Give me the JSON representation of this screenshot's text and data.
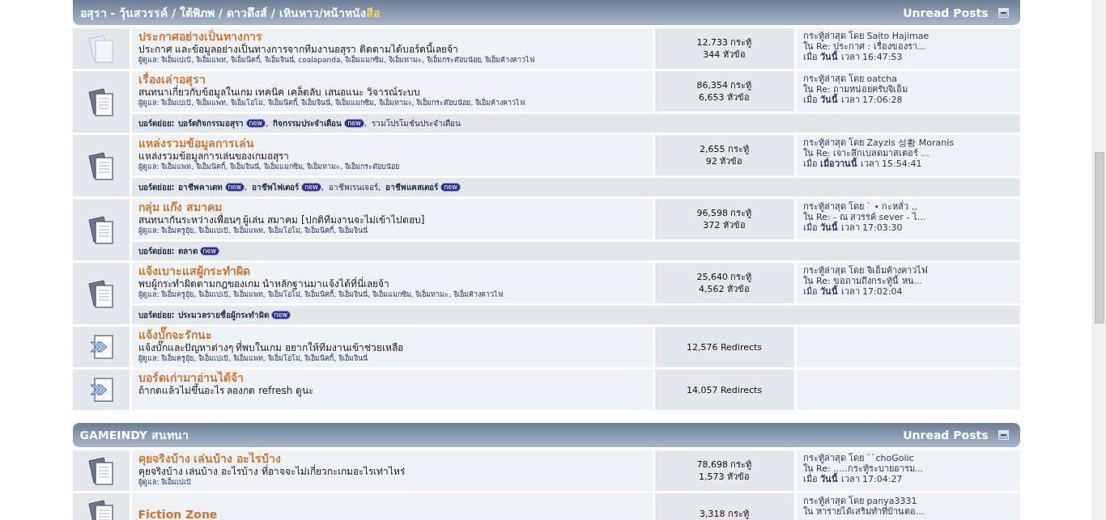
{
  "categories": [
    {
      "title_parts": [
        {
          "text": "อสุรา - วุ้นสวรรค์ / ใต้พิภพ / ดาวดึงส์ / เหินหาว/หน้าหนัง",
          "highlighted": false
        },
        {
          "text": "สือ",
          "highlighted": true
        }
      ],
      "unread_label": "Unread Posts",
      "forums": [
        {
          "kind": "forum",
          "unread": false,
          "title": "ประกาศอย่างเป็นทางการ",
          "description": "ประกาศ และข้อมูลอย่างเป็นทางการจากทีมงานอสุรา ติดตามได้บอร์ดนี้เลยจ้า",
          "moderators_label": "ผู้ดูแล:",
          "moderators": "จิเอ็มเปเป้, จิเอ็มแพท, จิเอ็มนิคกี้, จิเอ็มจินนี่, coalapanda, จิเอ็มแมกซิม, จิเอ็มทามะ, จิเอ็มกระต๊อบน้อย, จิเอ็มค้างคาวไฟ",
          "posts": "12,733 กระทู้",
          "threads": "344 หัวข้อ",
          "last_post": {
            "by_label": "กระทู้ล่าสุด โดย",
            "user": "Saito Hajimae",
            "in_label": "ใน",
            "thread": "Re: ประกาศ : เรื่องของรา...",
            "at_label": "เมื่อ",
            "day": "วันนี้",
            "time_label": "เวลา",
            "time": "16:47:53"
          }
        },
        {
          "kind": "forum",
          "unread": true,
          "title": "เรื่องเล่าอสุรา",
          "description": "สนทนาเกี่ยวกับข้อมูลในเกม เทคนิค เคล็ดลับ เสนอแนะ วิจารณ์ระบบ",
          "moderators_label": "ผู้ดูแล:",
          "moderators": "จิเอ็มเปเป้, จิเอ็มแพท, จิเอ็มโอโม่, จิเอ็มนิคกี้, จิเอ็มจินนี่, จิเอ็มแมกซิม, จิเอ็มทามะ, จิเอ็มกระต๊อบน้อย, จิเอ็มค้างคาวไฟ",
          "posts": "86,354 กระทู้",
          "threads": "6,653 หัวข้อ",
          "last_post": {
            "by_label": "กระทู้ล่าสุด โดย",
            "user": "oatcha",
            "in_label": "ใน",
            "thread": "Re: ถามหน่อยครับจิเอ็ม",
            "at_label": "เมื่อ",
            "day": "วันนี้",
            "time_label": "เวลา",
            "time": "17:06:28"
          },
          "subforums": {
            "label": "บอร์ดย่อย:",
            "separator": ",",
            "items": [
              {
                "name": "บอร์ดกิจกรรมอสุรา",
                "new": true,
                "badge": "new"
              },
              {
                "name": "กิจกรรมประจำเดือน",
                "new": true,
                "badge": "new"
              },
              {
                "name": "รวมโปรโมชั่นประจำเดือน",
                "new": false
              }
            ]
          }
        },
        {
          "kind": "forum",
          "unread": true,
          "title": "แหล่งรวมข้อมูลการเล่น",
          "description": "แหล่งรวมข้อมูลการเล่นของเกมอสุรา",
          "moderators_label": "ผู้ดูแล:",
          "moderators": "จิเอ็มแพท, จิเอ็มนิคกี้, จิเอ็มจินนี่, จิเอ็มแมกซิม, จิเอ็มทามะ, จิเอ็มกระต๊อบน้อย",
          "posts": "2,655 กระทู้",
          "threads": "92 หัวข้อ",
          "last_post": {
            "by_label": "กระทู้ล่าสุด โดย",
            "user": "Zayzis 성황 Moranis",
            "in_label": "ใน",
            "thread": "Re: เจาะลึกเบลดมาสเตอร์ ...",
            "at_label": "เมื่อ",
            "day": "เมื่อวานนี้",
            "time_label": "เวลา",
            "time": "15:54:41"
          },
          "subforums": {
            "label": "บอร์ดย่อย:",
            "separator": ",",
            "items": [
              {
                "name": "อาชีพคาเดท",
                "new": true,
                "badge": "new"
              },
              {
                "name": "อาชีพไฟเตอร์",
                "new": true,
                "badge": "new"
              },
              {
                "name": "อาชีพเรนเจอร์",
                "new": false
              },
              {
                "name": "อาชีพแคสเตอร์",
                "new": true,
                "badge": "new"
              }
            ]
          }
        },
        {
          "kind": "forum",
          "unread": true,
          "title": "กลุ่ม แก๊ง สมาคม",
          "description": "สนทนากันระหว่างเพื่อนๆ ผู้เล่น สมาคม [ปกติทีมงานจะไม่เข้าไปตอบ]",
          "moderators_label": "ผู้ดูแล:",
          "moderators": "จิเอ็มครูอุ้ย, จิเอ็มเปเป้, จิเอ็มแพท, จิเอ็มโอโม่, จิเอ็มนิคกี้, จิเอ็มจินนี่",
          "posts": "96,598 กระทู้",
          "threads": "372 หัวข้อ",
          "last_post": {
            "by_label": "กระทู้ล่าสุด โดย",
            "user": "` • กะหลั่ว ,,",
            "in_label": "ใน",
            "thread": "Re: - ณ สวรรค์ sever - ไ...",
            "at_label": "เมื่อ",
            "day": "วันนี้",
            "time_label": "เวลา",
            "time": "17:03:30"
          },
          "subforums": {
            "label": "บอร์ดย่อย:",
            "items": [
              {
                "name": "ตลาด",
                "new": true,
                "badge": "new"
              }
            ]
          }
        },
        {
          "kind": "forum",
          "unread": true,
          "title": "แจ้งเบาะแสผู้กระทำผิด",
          "description": "พบผู้กระทำผิดตามกฎของเกม นำหลักฐานมาแจ้งได้ที่นี่เลยจ้า",
          "moderators_label": "ผู้ดูแล:",
          "moderators": "จิเอ็มครูอุ้ย, จิเอ็มเปเป้, จิเอ็มแพท, จิเอ็มโอโม่, จิเอ็มนิคกี้, จิเอ็มจินนี่, จิเอ็มแมกซิม, จิเอ็มทามะ, จิเอ็มค้างคาวไฟ",
          "posts": "25,640 กระทู้",
          "threads": "4,562 หัวข้อ",
          "last_post": {
            "by_label": "กระทู้ล่าสุด โดย",
            "user": "จิเอ็มค้างคาวไฟ",
            "in_label": "ใน",
            "thread": "Re: ขอถามถึงกระทู้นี้ หน...",
            "at_label": "เมื่อ",
            "day": "วันนี้",
            "time_label": "เวลา",
            "time": "17:02:04"
          },
          "subforums": {
            "label": "บอร์ดย่อย:",
            "items": [
              {
                "name": "ประมวลรายชื่อผู้กระทำผิด",
                "new": true,
                "badge": "new"
              }
            ]
          }
        },
        {
          "kind": "redirect",
          "unread": true,
          "title": "แจ้งบั๊กจะรักนะ",
          "description": "แจ้งบั๊กและปัญหาต่างๆ ที่พบในเกม อยากให้ทีมงานเข้าช่วยเหลือ",
          "moderators_label": "ผู้ดูแล:",
          "moderators": "จิเอ็มครูอุ้ย, จิเอ็มเปเป้, จิเอ็มแพท, จิเอ็มโอโม่, จิเอ็มนิคกี้, จิเอ็มจินนี่",
          "redirects": "12,576 Redirects"
        },
        {
          "kind": "redirect",
          "unread": true,
          "title": "บอร์ดเก่ามาอ่านได้จ้า",
          "description": "ถ้ากดแล้วไม่ขึ้นอะไร ลองกด refresh ดูนะ",
          "redirects": "14,057 Redirects"
        }
      ]
    },
    {
      "title_parts": [
        {
          "text": "GAMEINDY สนทนา",
          "highlighted": false
        }
      ],
      "unread_label": "Unread Posts",
      "forums": [
        {
          "kind": "forum",
          "unread": true,
          "title": "คุยจริงบ้าง เล่นบ้าง อะไรบ้าง",
          "description": "คุยจริงบ้าง เล่นบ้าง อะไรบ้าง ที่อาจจะไม่เกี่ยวกะเกมอะไรเท่าไหร่",
          "moderators_label": "ผู้ดูแล:",
          "moderators": "จิเอ็มเปเป้",
          "posts": "78,698 กระทู้",
          "threads": "1,573 หัวข้อ",
          "last_post": {
            "by_label": "กระทู้ล่าสุด โดย",
            "user": "``choGoiic",
            "in_label": "ใน",
            "thread": "Re: .....กระทู้ระบายอารม...",
            "at_label": "เมื่อ",
            "day": "วันนี้",
            "time_label": "เวลา",
            "time": "17:04:27"
          }
        },
        {
          "kind": "forum",
          "unread": true,
          "title": "Fiction Zone",
          "posts": "3,318 กระทู้",
          "last_post": {
            "by_label": "กระทู้ล่าสุด โดย",
            "user": "panya3331",
            "in_label": "ใน",
            "thread": "หารายได้เสริมทำที่บ้านตอ..."
          }
        }
      ]
    }
  ]
}
